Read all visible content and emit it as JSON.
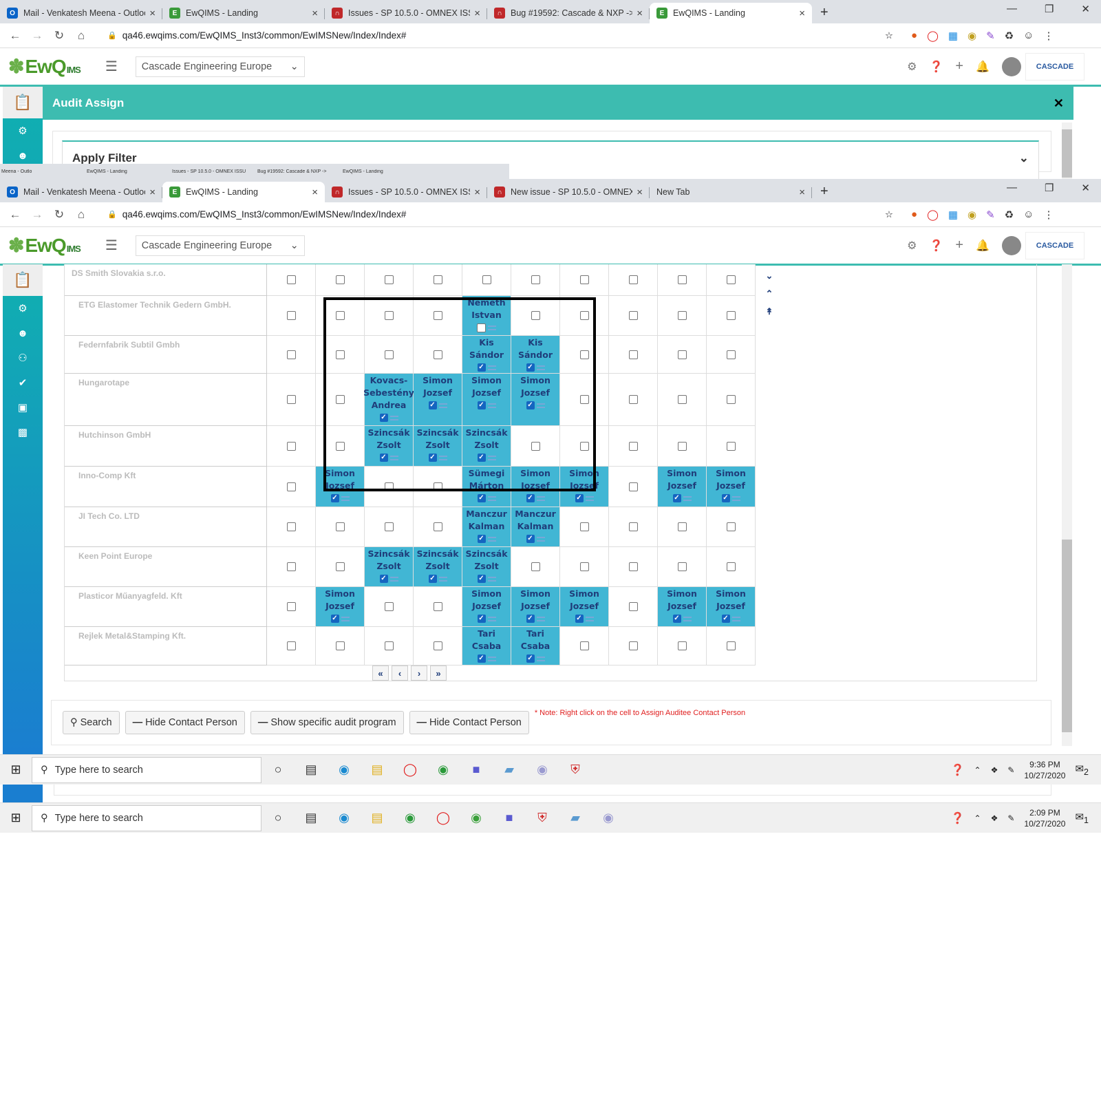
{
  "top_browser": {
    "tabs": [
      {
        "title": "Mail - Venkatesh Meena - Outlook",
        "icon": "outlook-icon",
        "color": "#0a64c8",
        "glyph": "O"
      },
      {
        "title": "EwQIMS - Landing",
        "icon": "ewqims-icon",
        "color": "#3a9a3a",
        "glyph": "E"
      },
      {
        "title": "Issues - SP 10.5.0 - OMNEX ISSUES",
        "icon": "redmine-icon",
        "color": "#c0282a",
        "glyph": "∩"
      },
      {
        "title": "Bug #19592: Cascade & NXP -> Au",
        "icon": "redmine-icon",
        "color": "#c0282a",
        "glyph": "∩"
      },
      {
        "title": "EwQIMS - Landing",
        "icon": "ewqims-icon",
        "color": "#3a9a3a",
        "glyph": "E"
      }
    ],
    "url": "qa46.ewqims.com/EwQIMS_Inst3/common/EwIMSNew/Index/Index#"
  },
  "inner_browser": {
    "mini_tabs": [
      "Meena - Outlo",
      "EwQIMS - Landing",
      "Issues - SP 10.5.0 - OMNEX ISSU",
      "Bug #19592: Cascade & NXP ->",
      "EwQIMS - Landing"
    ],
    "tabs": [
      {
        "title": "Mail - Venkatesh Meena - Outlook",
        "icon": "outlook-icon",
        "color": "#0a64c8",
        "glyph": "O"
      },
      {
        "title": "EwQIMS - Landing",
        "icon": "ewqims-icon",
        "color": "#3a9a3a",
        "glyph": "E"
      },
      {
        "title": "Issues - SP 10.5.0 - OMNEX ISSUES",
        "icon": "redmine-icon",
        "color": "#c0282a",
        "glyph": "∩"
      },
      {
        "title": "New issue - SP 10.5.0 - OMNEX IS",
        "icon": "redmine-icon",
        "color": "#c0282a",
        "glyph": "∩"
      },
      {
        "title": "New Tab",
        "icon": "",
        "color": "",
        "glyph": ""
      }
    ],
    "url": "qa46.ewqims.com/EwQIMS_Inst3/common/EwIMSNew/Index/Index#"
  },
  "app": {
    "logo_main": "EwQ",
    "logo_sup": "IMS",
    "logo_suffix": "MS",
    "company": "Cascade Engineering Europe",
    "brand": "CASCADE",
    "accent": "#3dbcb0",
    "title": "Audit Assign",
    "filter_title": "Apply Filter"
  },
  "grid": {
    "rows": [
      {
        "company": "DS Smith Slovakia s.r.o.",
        "height": 46,
        "cells": [
          null,
          null,
          null,
          null,
          null,
          null,
          null,
          null,
          null,
          null
        ]
      },
      {
        "company": "ETG Elastomer Technik Gedern GmbH.",
        "height": 58,
        "cells": [
          null,
          null,
          null,
          null,
          {
            "n": "Nemeth Istvan",
            "c": false
          },
          null,
          null,
          null,
          null,
          null
        ]
      },
      {
        "company": "Federnfabrik Subtil Gmbh",
        "height": 55,
        "cells": [
          null,
          null,
          null,
          null,
          {
            "n": "Kis Sándor",
            "c": true
          },
          {
            "n": "Kis Sándor",
            "c": true
          },
          null,
          null,
          null,
          null
        ]
      },
      {
        "company": "Hungarotape",
        "height": 76,
        "cells": [
          null,
          null,
          {
            "n": "Kovacs-Sebestény Andrea",
            "c": true
          },
          {
            "n": "Simon Jozsef",
            "c": true
          },
          {
            "n": "Simon Jozsef",
            "c": true
          },
          {
            "n": "Simon Jozsef",
            "c": true
          },
          null,
          null,
          null,
          null
        ]
      },
      {
        "company": "Hutchinson GmbH",
        "height": 59,
        "cells": [
          null,
          null,
          {
            "n": "Szincsák Zsolt",
            "c": true
          },
          {
            "n": "Szincsák Zsolt",
            "c": true
          },
          {
            "n": "Szincsák Zsolt",
            "c": true
          },
          null,
          null,
          null,
          null,
          null
        ]
      },
      {
        "company": "Inno-Comp Kft",
        "height": 59,
        "cells": [
          null,
          {
            "n": "Simon Jozsef",
            "c": true
          },
          null,
          null,
          {
            "n": "Sümegi Márton",
            "c": true
          },
          {
            "n": "Simon Jozsef",
            "c": true
          },
          {
            "n": "Simon Jozsef",
            "c": true
          },
          null,
          {
            "n": "Simon Jozsef",
            "c": true
          },
          {
            "n": "Simon Jozsef",
            "c": true
          }
        ]
      },
      {
        "company": "JI Tech Co. LTD",
        "height": 58,
        "cells": [
          null,
          null,
          null,
          null,
          {
            "n": "Manczur Kalman",
            "c": true
          },
          {
            "n": "Manczur Kalman",
            "c": true
          },
          null,
          null,
          null,
          null
        ]
      },
      {
        "company": "Keen Point Europe",
        "height": 58,
        "cells": [
          null,
          null,
          {
            "n": "Szincsák Zsolt",
            "c": true
          },
          {
            "n": "Szincsák Zsolt",
            "c": true
          },
          {
            "n": "Szincsák Zsolt",
            "c": true
          },
          null,
          null,
          null,
          null,
          null
        ]
      },
      {
        "company": "Plasticor Műanyagfeld. Kft",
        "height": 58,
        "cells": [
          null,
          {
            "n": "Simon Jozsef",
            "c": true
          },
          null,
          null,
          {
            "n": "Simon Jozsef",
            "c": true
          },
          {
            "n": "Simon Jozsef",
            "c": true
          },
          {
            "n": "Simon Jozsef",
            "c": true
          },
          null,
          {
            "n": "Simon Jozsef",
            "c": true
          },
          {
            "n": "Simon Jozsef",
            "c": true
          }
        ]
      },
      {
        "company": "Rejlek Metal&Stamping Kft.",
        "height": 56,
        "cells": [
          null,
          null,
          null,
          null,
          {
            "n": "Tari Csaba",
            "c": true
          },
          {
            "n": "Tari Csaba",
            "c": true
          },
          null,
          null,
          null,
          null
        ]
      }
    ]
  },
  "buttons": {
    "search": "Search",
    "hide1": "Hide Contact Person",
    "show_program": "Show specific audit program",
    "hide2": "Hide Contact Person"
  },
  "note": "* Note: Right click on the cell to Assign Auditee Contact Person",
  "taskbar_top": {
    "search_placeholder": "Type here to search",
    "time": "9:36 PM",
    "date": "10/27/2020",
    "notif": "2"
  },
  "taskbar_bottom": {
    "search_placeholder": "Type here to search",
    "time": "2:09 PM",
    "date": "10/27/2020",
    "notif": "1"
  }
}
